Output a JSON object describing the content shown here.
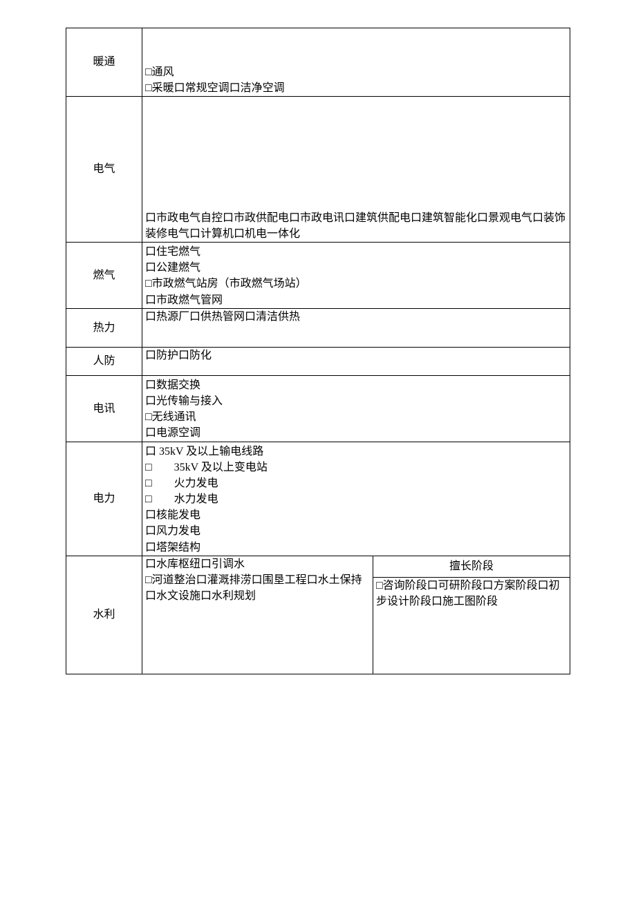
{
  "rows": {
    "hvac": {
      "label": "暖通",
      "line1": "□通风",
      "line2": "□采暖口常规空调口洁净空调"
    },
    "electrical": {
      "label": "电气",
      "content": "口市政电气自控口市政供配电口市政电讯口建筑供配电口建筑智能化口景观电气口装饰装修电气口计算机口机电一体化"
    },
    "gas": {
      "label": "燃气",
      "l1": "口住宅燃气",
      "l2": "口公建燃气",
      "l3": "□市政燃气站房（市政燃气场站）",
      "l4": "口市政燃气管网"
    },
    "heat": {
      "label": "热力",
      "content": "口热源厂口供热管网口清洁供热"
    },
    "defense": {
      "label": "人防",
      "content": "口防护口防化"
    },
    "telecom": {
      "label": "电讯",
      "l1": "口数据交换",
      "l2": "口光传输与接入",
      "l3": "□无线通讯",
      "l4": "口电源空调"
    },
    "power": {
      "label": "电力",
      "l1": "口 35kV 及以上输电线路",
      "l2": "□　　35kV 及以上变电站",
      "l3": "□　　火力发电",
      "l4": "□　　水力发电",
      "l5": "口核能发电",
      "l6": "口风力发电",
      "l7": "口塔架结构"
    },
    "water": {
      "label": "水利",
      "left_l1": "口水库枢纽口引调水",
      "left_l2": "□河道整治口灌溉排涝口围垦工程口水土保持口水文设施口水利规划",
      "stage_header": "擅长阶段",
      "stage_content": "□咨询阶段口可研阶段口方案阶段口初步设计阶段口施工图阶段"
    }
  }
}
